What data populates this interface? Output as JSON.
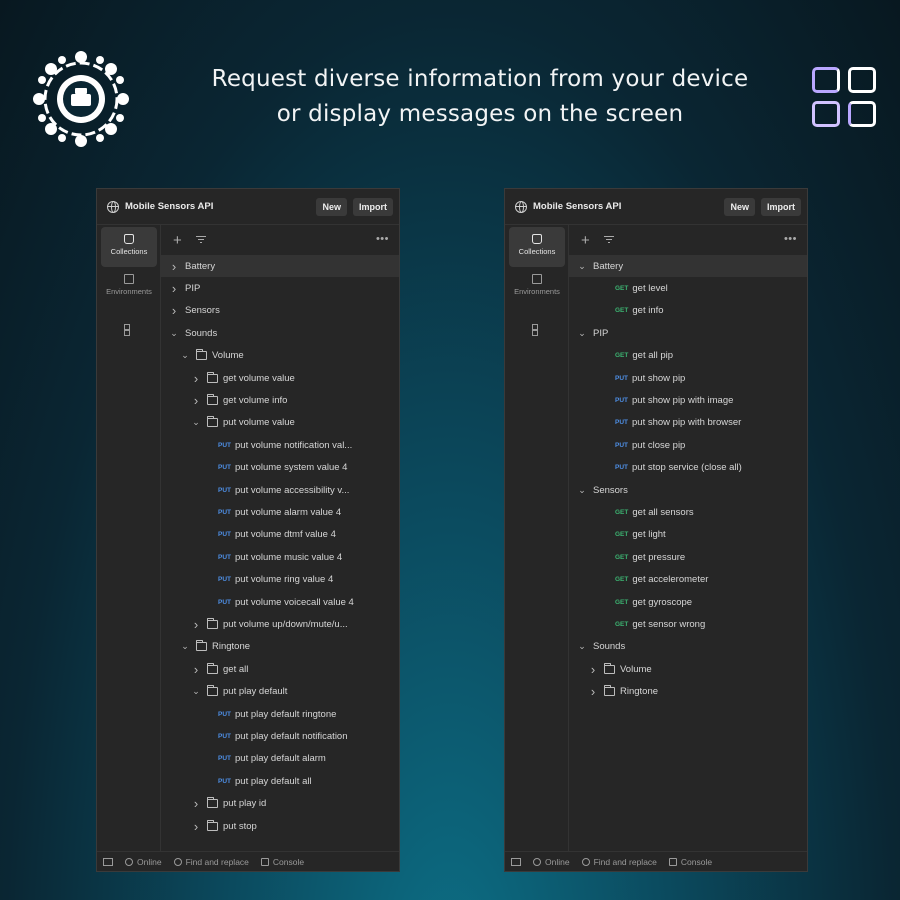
{
  "headline": {
    "line1": "Request diverse information from your device",
    "line2": "or display messages on the screen"
  },
  "panels": {
    "left": {
      "workspace_title": "Mobile Sensors API",
      "new_label": "New",
      "import_label": "Import",
      "sidebar": {
        "collections": "Collections",
        "environments": "Environments"
      },
      "status": {
        "online": "Online",
        "find": "Find and replace",
        "console": "Console"
      },
      "tree": [
        {
          "label": "Battery",
          "depth": 0,
          "chevron": ">",
          "folder": false,
          "method": "",
          "highlight": true
        },
        {
          "label": "PIP",
          "depth": 0,
          "chevron": ">",
          "folder": false,
          "method": ""
        },
        {
          "label": "Sensors",
          "depth": 0,
          "chevron": ">",
          "folder": false,
          "method": ""
        },
        {
          "label": "Sounds",
          "depth": 0,
          "chevron": "v",
          "folder": false,
          "method": ""
        },
        {
          "label": "Volume",
          "depth": 1,
          "chevron": "v",
          "folder": true,
          "method": ""
        },
        {
          "label": "get volume value",
          "depth": 2,
          "chevron": ">",
          "folder": true,
          "method": ""
        },
        {
          "label": "get volume info",
          "depth": 2,
          "chevron": ">",
          "folder": true,
          "method": ""
        },
        {
          "label": "put volume value",
          "depth": 2,
          "chevron": "v",
          "folder": true,
          "method": ""
        },
        {
          "label": "put volume notification val...",
          "depth": 3,
          "chevron": "",
          "folder": false,
          "method": "PUT"
        },
        {
          "label": "put volume system value 4",
          "depth": 3,
          "chevron": "",
          "folder": false,
          "method": "PUT"
        },
        {
          "label": "put volume accessibility v...",
          "depth": 3,
          "chevron": "",
          "folder": false,
          "method": "PUT"
        },
        {
          "label": "put volume alarm value 4",
          "depth": 3,
          "chevron": "",
          "folder": false,
          "method": "PUT"
        },
        {
          "label": "put volume dtmf value 4",
          "depth": 3,
          "chevron": "",
          "folder": false,
          "method": "PUT"
        },
        {
          "label": "put volume music value 4",
          "depth": 3,
          "chevron": "",
          "folder": false,
          "method": "PUT"
        },
        {
          "label": "put volume ring value 4",
          "depth": 3,
          "chevron": "",
          "folder": false,
          "method": "PUT"
        },
        {
          "label": "put volume voicecall value 4",
          "depth": 3,
          "chevron": "",
          "folder": false,
          "method": "PUT"
        },
        {
          "label": "put volume up/down/mute/u...",
          "depth": 2,
          "chevron": ">",
          "folder": true,
          "method": ""
        },
        {
          "label": "Ringtone",
          "depth": 1,
          "chevron": "v",
          "folder": true,
          "method": ""
        },
        {
          "label": "get all",
          "depth": 2,
          "chevron": ">",
          "folder": true,
          "method": ""
        },
        {
          "label": "put play default",
          "depth": 2,
          "chevron": "v",
          "folder": true,
          "method": ""
        },
        {
          "label": "put play default ringtone",
          "depth": 3,
          "chevron": "",
          "folder": false,
          "method": "PUT"
        },
        {
          "label": "put play default notification",
          "depth": 3,
          "chevron": "",
          "folder": false,
          "method": "PUT"
        },
        {
          "label": "put play default alarm",
          "depth": 3,
          "chevron": "",
          "folder": false,
          "method": "PUT"
        },
        {
          "label": "put play default all",
          "depth": 3,
          "chevron": "",
          "folder": false,
          "method": "PUT"
        },
        {
          "label": "put play id",
          "depth": 2,
          "chevron": ">",
          "folder": true,
          "method": ""
        },
        {
          "label": "put stop",
          "depth": 2,
          "chevron": ">",
          "folder": true,
          "method": ""
        }
      ]
    },
    "right": {
      "workspace_title": "Mobile Sensors API",
      "new_label": "New",
      "import_label": "Import",
      "sidebar": {
        "collections": "Collections",
        "environments": "Environments"
      },
      "status": {
        "online": "Online",
        "find": "Find and replace",
        "console": "Console"
      },
      "tree": [
        {
          "label": "Battery",
          "depth": 0,
          "chevron": "v",
          "folder": false,
          "method": "",
          "highlight": true
        },
        {
          "label": "get level",
          "depth": 2,
          "chevron": "",
          "folder": false,
          "method": "GET"
        },
        {
          "label": "get info",
          "depth": 2,
          "chevron": "",
          "folder": false,
          "method": "GET"
        },
        {
          "label": "PIP",
          "depth": 0,
          "chevron": "v",
          "folder": false,
          "method": ""
        },
        {
          "label": "get all pip",
          "depth": 2,
          "chevron": "",
          "folder": false,
          "method": "GET"
        },
        {
          "label": "put show pip",
          "depth": 2,
          "chevron": "",
          "folder": false,
          "method": "PUT"
        },
        {
          "label": "put show pip with image",
          "depth": 2,
          "chevron": "",
          "folder": false,
          "method": "PUT"
        },
        {
          "label": "put show pip with browser",
          "depth": 2,
          "chevron": "",
          "folder": false,
          "method": "PUT"
        },
        {
          "label": "put close pip",
          "depth": 2,
          "chevron": "",
          "folder": false,
          "method": "PUT"
        },
        {
          "label": "put stop service (close all)",
          "depth": 2,
          "chevron": "",
          "folder": false,
          "method": "PUT"
        },
        {
          "label": "Sensors",
          "depth": 0,
          "chevron": "v",
          "folder": false,
          "method": ""
        },
        {
          "label": "get all sensors",
          "depth": 2,
          "chevron": "",
          "folder": false,
          "method": "GET"
        },
        {
          "label": "get light",
          "depth": 2,
          "chevron": "",
          "folder": false,
          "method": "GET"
        },
        {
          "label": "get pressure",
          "depth": 2,
          "chevron": "",
          "folder": false,
          "method": "GET"
        },
        {
          "label": "get accelerometer",
          "depth": 2,
          "chevron": "",
          "folder": false,
          "method": "GET"
        },
        {
          "label": "get gyroscope",
          "depth": 2,
          "chevron": "",
          "folder": false,
          "method": "GET"
        },
        {
          "label": "get sensor wrong",
          "depth": 2,
          "chevron": "",
          "folder": false,
          "method": "GET"
        },
        {
          "label": "Sounds",
          "depth": 0,
          "chevron": "v",
          "folder": false,
          "method": ""
        },
        {
          "label": "Volume",
          "depth": 1,
          "chevron": ">",
          "folder": true,
          "method": ""
        },
        {
          "label": "Ringtone",
          "depth": 1,
          "chevron": ">",
          "folder": true,
          "method": ""
        }
      ]
    }
  }
}
